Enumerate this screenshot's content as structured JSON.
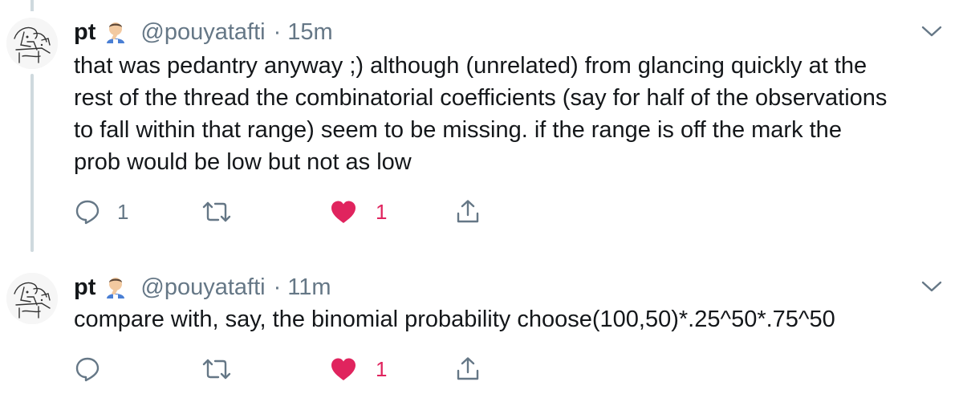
{
  "tweets": [
    {
      "display_name": "pt",
      "handle": "@pouyatafti",
      "separator": "·",
      "time": "15m",
      "text": "that was pedantry anyway ;) although (unrelated) from glancing quickly at the\nrest of the thread the combinatorial coefficients (say for half of the observations\nto fall within that range) seem to be missing.  if the range is off the mark the\nprob would be low but not as low",
      "reply_count": "1",
      "retweet_count": "",
      "like_count": "1",
      "liked": true
    },
    {
      "display_name": "pt",
      "handle": "@pouyatafti",
      "separator": "·",
      "time": "11m",
      "text": "compare with, say, the binomial probability choose(100,50)*.25^50*.75^50",
      "reply_count": "",
      "retweet_count": "",
      "like_count": "1",
      "liked": true
    }
  ],
  "icons": {
    "reply": "speech-bubble-icon",
    "retweet": "retweet-icon",
    "like": "heart-icon",
    "share": "share-upload-icon",
    "menu": "chevron-down-icon",
    "emoji": "person-facepalming-emoji"
  },
  "colors": {
    "text": "#14171a",
    "secondary": "#657786",
    "like": "#e0245e",
    "thread_line": "#cfd9de"
  }
}
